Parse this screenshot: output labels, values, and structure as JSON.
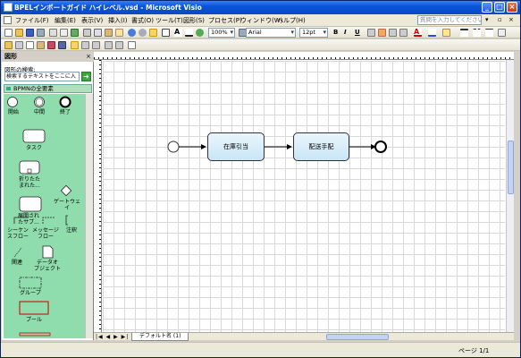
{
  "window": {
    "title": "BPELインポートガイド ハイレベル.vsd - Microsoft Visio",
    "controls": [
      "_",
      "□",
      "×"
    ]
  },
  "menu": {
    "items": [
      "ファイル(F)",
      "編集(E)",
      "表示(V)",
      "挿入(I)",
      "書式(O)",
      "ツール(T)",
      "図形(S)",
      "プロセス(P)",
      "ウィンドウ(W)",
      "ヘルプ(H)"
    ],
    "help_placeholder": "質問を入力してください"
  },
  "toolbar": {
    "zoom": "100%",
    "font": "Arial",
    "font_size": "12pt",
    "bold": "B",
    "italic": "I",
    "underline": "U"
  },
  "shapes_pane": {
    "title": "図形",
    "close": "×",
    "search_label": "図形の検索:",
    "search_placeholder": "検索するテキストをここに入",
    "stencil_title": "BPMNの全要素",
    "items": [
      {
        "label": "開始"
      },
      {
        "label": "中間"
      },
      {
        "label": "終了"
      },
      {
        "label": "タスク"
      },
      {
        "label": "折りたた\nまれた..."
      },
      {
        "label": "展開され\nたサブ..."
      },
      {
        "label": "ゲートウェ\nイ"
      },
      {
        "label": "シーケン\nスフロー"
      },
      {
        "label": "メッセージ\nフロー"
      },
      {
        "label": "注釈"
      },
      {
        "label": "関連"
      },
      {
        "label": "データオ\nブジェクト"
      },
      {
        "label": "グループ"
      },
      {
        "label": "プール"
      }
    ]
  },
  "diagram": {
    "process1": "在庫引当",
    "process2": "配送手配"
  },
  "page_tab": "デフォルト名 (1)",
  "status": {
    "page": "ページ 1/1"
  },
  "colors": {
    "title_bar": "#0a55d9",
    "stencil_bg": "#8fdcad",
    "process_fill": "#d7eef9"
  }
}
